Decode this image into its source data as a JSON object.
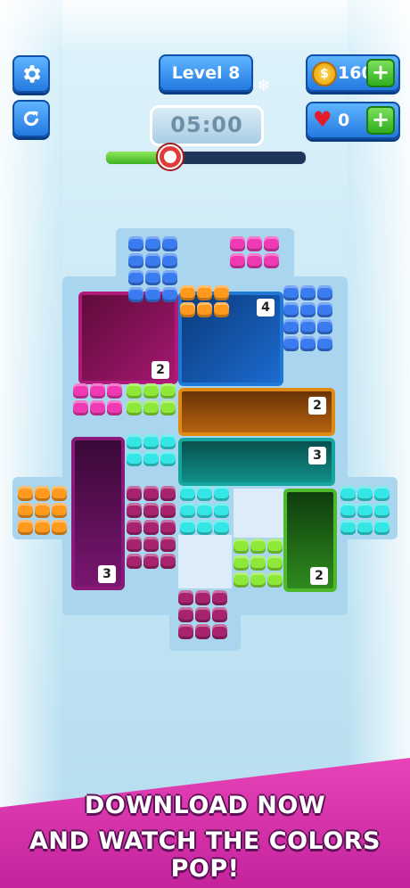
{
  "hud": {
    "level_label": "Level 8",
    "coins": "160",
    "lives": "0",
    "timer": "05:00",
    "progress": 0.32
  },
  "icons": {
    "settings": "gear-icon",
    "restart": "restart-icon",
    "coin": "coin-icon",
    "heart": "heart-icon",
    "plus": "plus-icon",
    "clock": "alarm-clock-icon"
  },
  "board": {
    "holes": [
      {
        "color": "#b0187a",
        "label": "2"
      },
      {
        "color": "#1f78d6",
        "label": "4"
      },
      {
        "color": "#e08a12",
        "label": "2"
      },
      {
        "color": "#15a6a0",
        "label": "3"
      },
      {
        "color": "#8a1a7a",
        "label": "3"
      },
      {
        "color": "#4cb82a",
        "label": "2"
      }
    ]
  },
  "colors": {
    "blue": "#3a7bf0",
    "pink": "#f03ab4",
    "orange": "#ff9a1f",
    "lime": "#8ee83a",
    "cyan": "#35e6e6",
    "plum": "#a8236e"
  },
  "banner": {
    "line1": "DOWNLOAD NOW",
    "line2": "AND WATCH THE COLORS POP!"
  }
}
